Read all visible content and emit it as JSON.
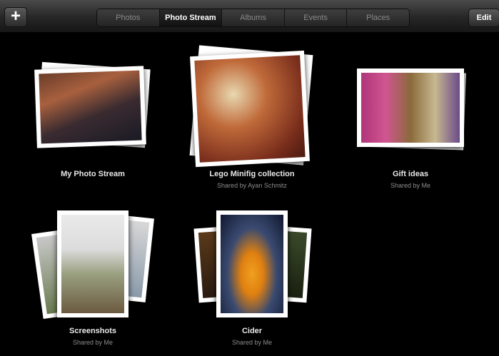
{
  "toolbar": {
    "add_label": "+",
    "tabs": [
      "Photos",
      "Photo Stream",
      "Albums",
      "Events",
      "Places"
    ],
    "active_tab": "Photo Stream",
    "edit_label": "Edit"
  },
  "albums": [
    {
      "title": "My Photo Stream",
      "subtitle": ""
    },
    {
      "title": "Lego Minifig collection",
      "subtitle": "Shared by Ayan Schmitz"
    },
    {
      "title": "Gift ideas",
      "subtitle": "Shared by Me"
    },
    {
      "title": "Screenshots",
      "subtitle": "Shared by Me"
    },
    {
      "title": "Cider",
      "subtitle": "Shared by Me"
    }
  ]
}
